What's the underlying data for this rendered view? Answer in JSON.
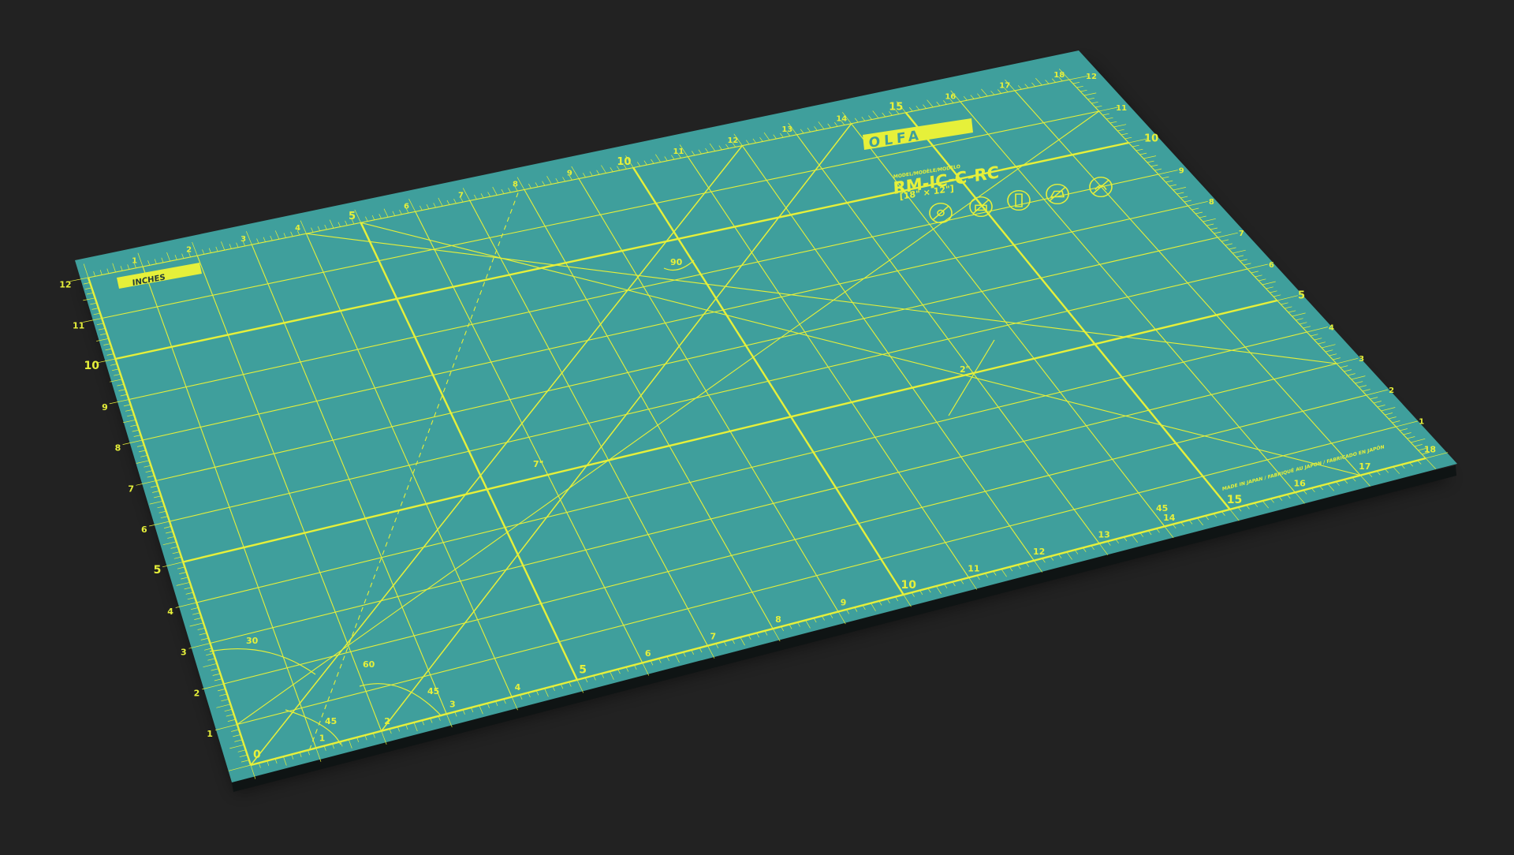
{
  "colors": {
    "background": "#222222",
    "mat": "#3f9f9c",
    "mat_edge": "#0f1414",
    "print": "#e6f03a",
    "badge_text": "#233c3a"
  },
  "mat": {
    "brand": "OLFA",
    "model_caption": "MODEL/MODÈLE/MODELO",
    "model": "RM-IC-C-RC",
    "size": "[18\" × 12\"]",
    "units_badge": "INCHES",
    "made_in": "MADE IN JAPAN / FABRIQUÉ AU JAPON / FABRICADO EN JAPÓN",
    "grid_inches": {
      "width": 18,
      "height": 12
    },
    "angle_labels": [
      "30",
      "45",
      "60",
      "90"
    ],
    "dimension_labels": [
      "7\"",
      "2\""
    ],
    "care_icons": [
      "no-heat-icon",
      "no-sun-icon",
      "store-flat-icon",
      "no-iron-icon",
      "no-dishwasher-icon"
    ]
  }
}
